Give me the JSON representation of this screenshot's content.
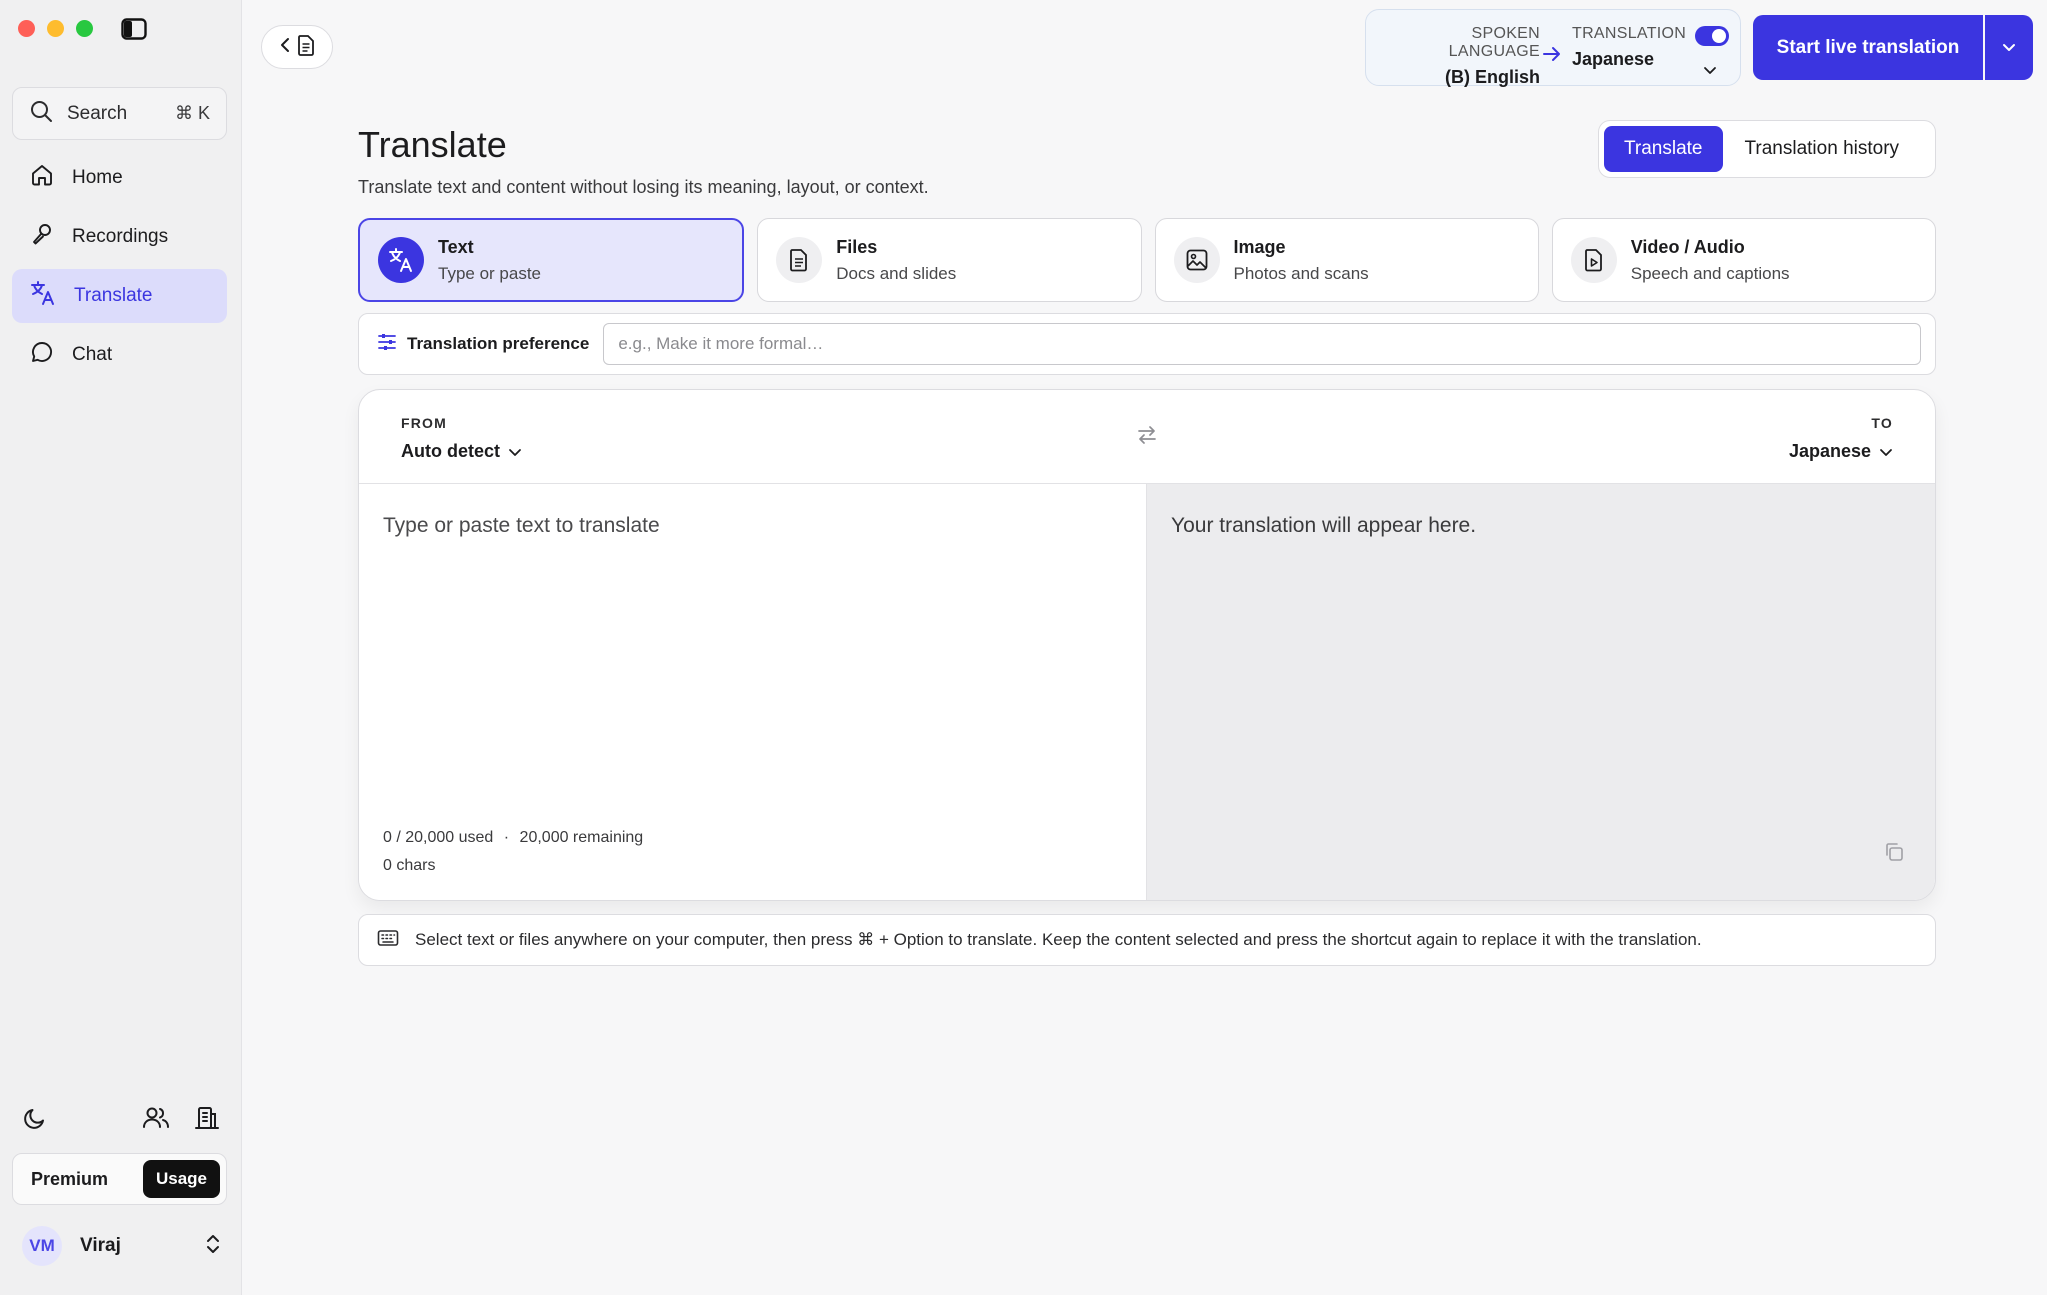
{
  "sidebar": {
    "search": {
      "label": "Search",
      "shortcut": "⌘ K"
    },
    "nav": [
      {
        "label": "Home",
        "icon": "home-icon"
      },
      {
        "label": "Recordings",
        "icon": "microphone-icon"
      },
      {
        "label": "Translate",
        "icon": "translate-icon",
        "active": true
      },
      {
        "label": "Chat",
        "icon": "chat-bubble-icon"
      }
    ],
    "plan": {
      "premium_label": "Premium",
      "usage_label": "Usage"
    },
    "user": {
      "initials": "VM",
      "name": "Viraj"
    }
  },
  "topbar": {
    "language": {
      "spoken_caption": "SPOKEN LANGUAGE",
      "spoken_value": "(B) English",
      "translation_caption": "TRANSLATION",
      "translation_value": "Japanese",
      "translation_enabled": true
    },
    "start_button": "Start live translation"
  },
  "page": {
    "title": "Translate",
    "subtitle": "Translate text and content without losing its meaning, layout, or context.",
    "tabs": {
      "active": "Translate",
      "other": "Translation history"
    }
  },
  "modes": [
    {
      "title": "Text",
      "subtitle": "Type or paste",
      "icon": "translate-icon",
      "active": true
    },
    {
      "title": "Files",
      "subtitle": "Docs and slides",
      "icon": "document-icon"
    },
    {
      "title": "Image",
      "subtitle": "Photos and scans",
      "icon": "image-icon"
    },
    {
      "title": "Video / Audio",
      "subtitle": "Speech and captions",
      "icon": "video-file-icon"
    }
  ],
  "preference": {
    "label": "Translation preference",
    "placeholder": "e.g., Make it more formal…"
  },
  "translator": {
    "from_caption": "FROM",
    "from_value": "Auto detect",
    "to_caption": "TO",
    "to_value": "Japanese",
    "input_placeholder": "Type or paste text to translate",
    "output_placeholder": "Your translation will appear here.",
    "usage": "0 / 20,000 used",
    "separator": "·",
    "remaining": "20,000 remaining",
    "chars": "0 chars"
  },
  "tip": "Select text or files anywhere on your computer, then press ⌘ + Option to translate. Keep the content selected and press the shortcut again to replace it with the translation.",
  "colors": {
    "accent": "#3b35e0",
    "accent_soft": "#e6e6fc",
    "background": "#f7f7f8"
  }
}
